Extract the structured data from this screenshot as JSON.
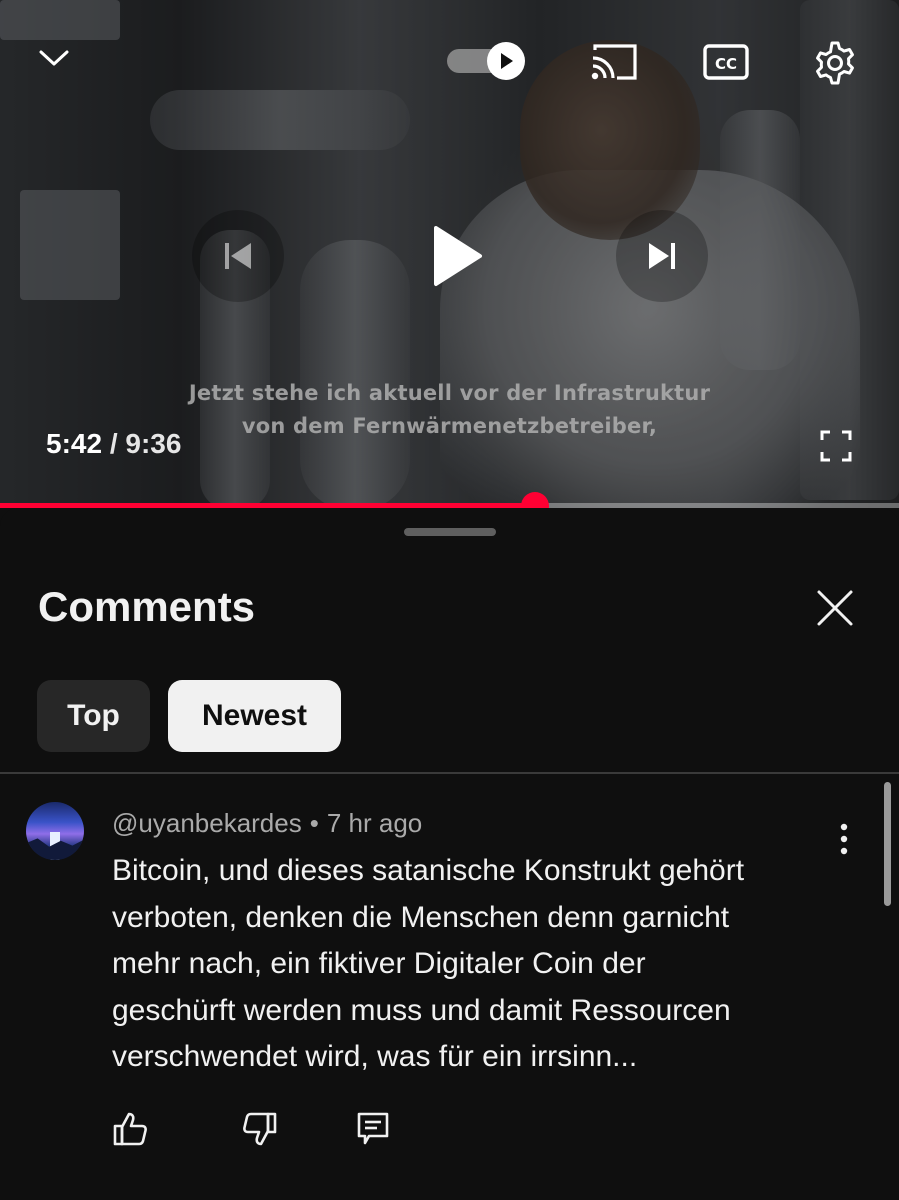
{
  "player": {
    "subtitle_lines": [
      "Jetzt stehe ich aktuell vor der Infrastruktur",
      "von dem Fernwärmenetzbetreiber,"
    ],
    "current_time": "5:42",
    "separator": " / ",
    "duration": "9:36",
    "progress_fraction": 0.595,
    "accent_color": "#ff0033",
    "icons": {
      "collapse": "chevron-down-icon",
      "autoplay": "autoplay-toggle",
      "cast": "cast-icon",
      "captions": "cc-icon",
      "settings": "gear-icon",
      "previous": "skip-previous-icon",
      "play": "play-icon",
      "next": "skip-next-icon",
      "fullscreen": "fullscreen-icon"
    },
    "captions_label": "CC"
  },
  "comments": {
    "title": "Comments",
    "filters": [
      "Top",
      "Newest"
    ],
    "selected_filter": "Newest",
    "items": [
      {
        "author": "@uyanbekardes",
        "separator": "•",
        "time_ago": "7 hr ago",
        "text_lines": [
          "Bitcoin, und dieses satanische Konstrukt gehört",
          "verboten, denken die Menschen denn garnicht",
          "mehr nach, ein fiktiver Digitaler Coin der",
          "geschürft werden muss und damit Ressourcen",
          "verschwendet wird, was für ein irrsinn..."
        ],
        "actions": [
          "like-icon",
          "dislike-icon",
          "reply-icon"
        ]
      }
    ]
  }
}
